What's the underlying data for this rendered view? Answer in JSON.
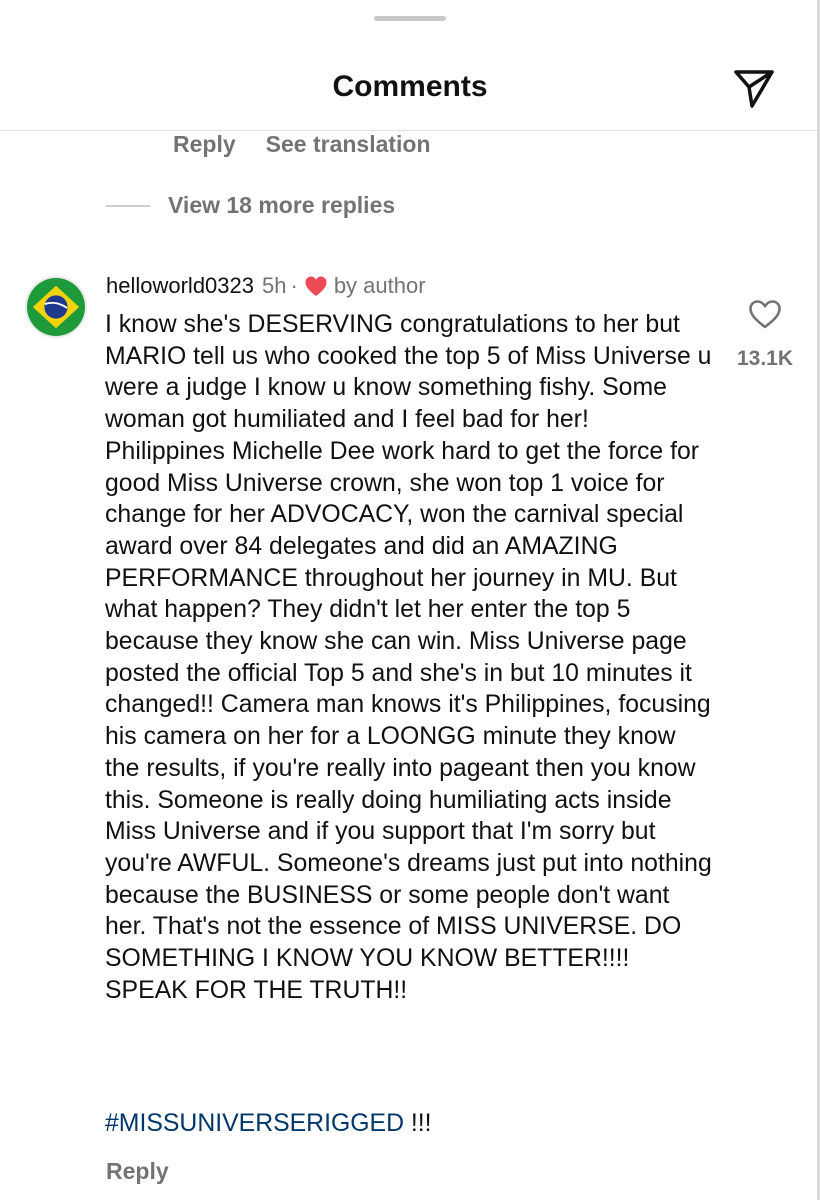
{
  "header": {
    "title": "Comments",
    "send_icon": "paper-plane-icon"
  },
  "previous_comment": {
    "reply_label": "Reply",
    "see_translation_label": "See translation",
    "view_more_replies": "View 18 more replies"
  },
  "comment": {
    "avatar": "brazil-flag-avatar",
    "username": "helloworld0323",
    "time": "5h",
    "separator": "·",
    "author_badge_icon": "red-heart-icon",
    "author_badge_text": "by author",
    "text": "I know she's DESERVING congratulations to her but MARIO tell us who cooked the top 5 of Miss Universe u were a judge I know u know something fishy. Some woman got humiliated and I feel bad for her! Philippines Michelle Dee work hard to get the force for good Miss Universe crown, she won top 1 voice for change for her ADVOCACY, won the carnival special award over 84 delegates and did an AMAZING PERFORMANCE throughout her journey in MU. But what happen? They didn't let her enter the top 5 because they know she can win. Miss Universe page posted the official Top 5 and she's in but 10 minutes it changed!! Camera man knows it's Philippines, focusing his camera on her for a LOONGG minute they know the results, if you're really into pageant then you know this. Someone is really doing humiliating acts inside Miss Universe and if you support that I'm sorry but you're AWFUL. Someone's dreams just put into nothing because the BUSINESS or some people don't want her. That's not the essence of MISS UNIVERSE. DO SOMETHING I KNOW YOU KNOW BETTER!!!! SPEAK FOR THE TRUTH!!",
    "hashtag": "#MISSUNIVERSERIGGED",
    "hashtag_suffix": " !!!",
    "like_icon": "heart-outline-icon",
    "like_count": "13.1K",
    "reply_label": "Reply"
  },
  "colors": {
    "secondary_text": "#737373",
    "hashtag": "#00376b",
    "heart_red": "#ed4956"
  }
}
